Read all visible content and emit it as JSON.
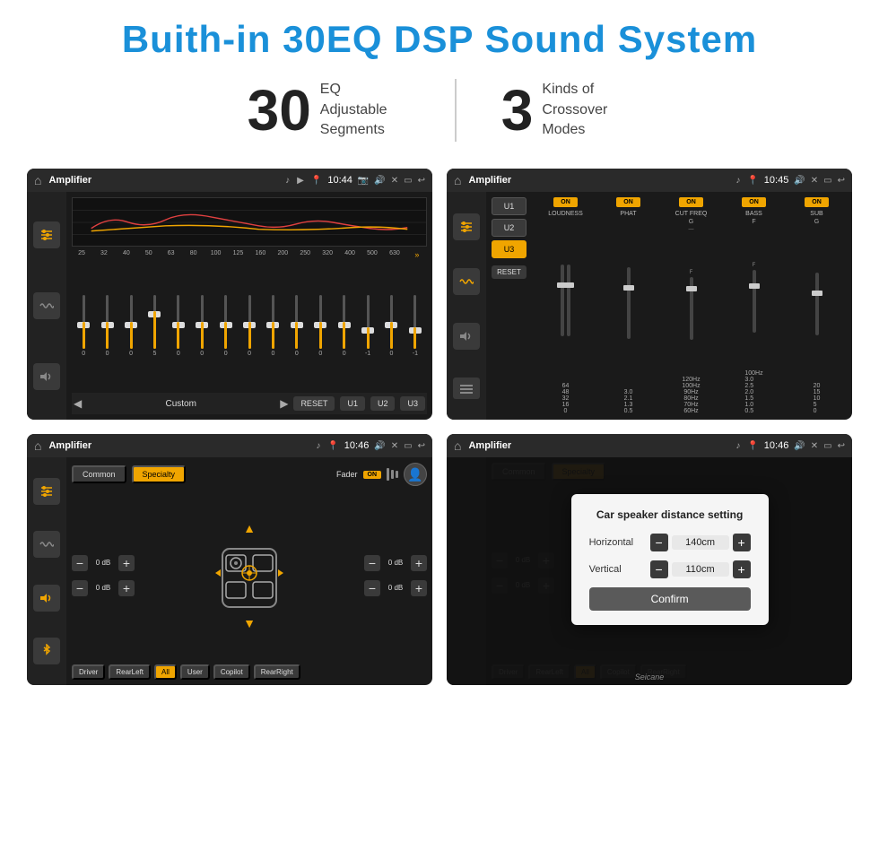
{
  "page": {
    "title": "Buith-in 30EQ DSP Sound System",
    "stat1_number": "30",
    "stat1_text_line1": "EQ Adjustable",
    "stat1_text_line2": "Segments",
    "stat2_number": "3",
    "stat2_text_line1": "Kinds of",
    "stat2_text_line2": "Crossover Modes"
  },
  "screen1": {
    "header_title": "Amplifier",
    "header_time": "10:44",
    "eq_bands": [
      "25",
      "32",
      "40",
      "50",
      "63",
      "80",
      "100",
      "125",
      "160",
      "200",
      "250",
      "320",
      "400",
      "500",
      "630"
    ],
    "eq_values": [
      "0",
      "0",
      "0",
      "5",
      "0",
      "0",
      "0",
      "0",
      "0",
      "0",
      "0",
      "0",
      "-1",
      "0",
      "-1"
    ],
    "bottom_label": "Custom",
    "btn_reset": "RESET",
    "btn_u1": "U1",
    "btn_u2": "U2",
    "btn_u3": "U3"
  },
  "screen2": {
    "header_title": "Amplifier",
    "header_time": "10:45",
    "presets": [
      "U1",
      "U2",
      "U3"
    ],
    "active_preset": "U3",
    "channels": [
      {
        "name": "LOUDNESS",
        "on": true
      },
      {
        "name": "PHAT",
        "on": true
      },
      {
        "name": "CUT FREQ",
        "on": true
      },
      {
        "name": "BASS",
        "on": true
      },
      {
        "name": "SUB",
        "on": true
      }
    ],
    "btn_reset": "RESET"
  },
  "screen3": {
    "header_title": "Amplifier",
    "header_time": "10:46",
    "tab_common": "Common",
    "tab_specialty": "Specialty",
    "active_tab": "Specialty",
    "fader_label": "Fader",
    "fader_on": "ON",
    "zones": [
      {
        "label": "Driver"
      },
      {
        "label": "RearLeft"
      },
      {
        "label": "All",
        "active": true
      },
      {
        "label": "User"
      },
      {
        "label": "Copilot"
      },
      {
        "label": "RearRight"
      }
    ],
    "db_values": [
      "0 dB",
      "0 dB",
      "0 dB",
      "0 dB"
    ]
  },
  "screen4": {
    "header_title": "Amplifier",
    "header_time": "10:46",
    "dialog_title": "Car speaker distance setting",
    "horizontal_label": "Horizontal",
    "horizontal_value": "140cm",
    "vertical_label": "Vertical",
    "vertical_value": "110cm",
    "confirm_label": "Confirm",
    "tab_common": "Common",
    "tab_specialty": "Specialty",
    "db_value1": "0 dB",
    "db_value2": "0 dB",
    "zones": [
      {
        "label": "Driver"
      },
      {
        "label": "RearLeft"
      },
      {
        "label": "All",
        "active": true
      },
      {
        "label": "Copilot"
      },
      {
        "label": "RearRight"
      }
    ]
  },
  "watermark": "Seicane"
}
